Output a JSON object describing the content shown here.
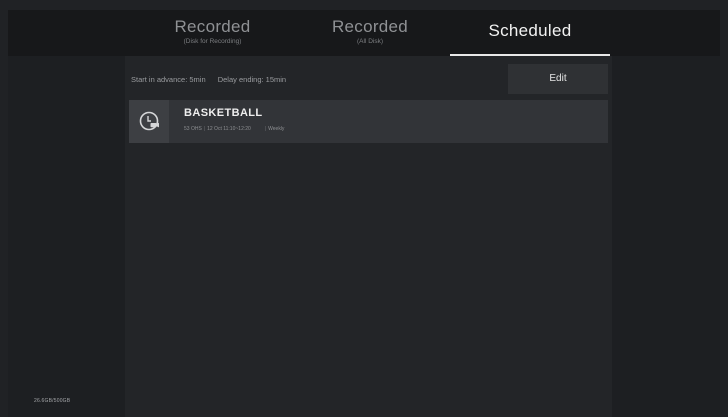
{
  "tabs": [
    {
      "title": "Recorded",
      "subtitle": "(Disk for Recording)",
      "active": false
    },
    {
      "title": "Recorded",
      "subtitle": "(All Disk)",
      "active": false
    },
    {
      "title": "Scheduled",
      "subtitle": "",
      "active": true
    }
  ],
  "settings": {
    "start_in_advance": "Start in advance: 5min",
    "delay_ending": "Delay ending: 15min"
  },
  "toolbar": {
    "edit_label": "Edit"
  },
  "schedule_items": [
    {
      "title": "BASKETBALL",
      "channel": "53 OHS",
      "time": "12 Oct 11:10~12:20",
      "repeat": "Weekly",
      "icon": "clock-record-icon"
    }
  ],
  "footer": {
    "disk_usage": "26.6GB/500GB"
  },
  "colors": {
    "background": "#202225",
    "tabbar": "#17181a",
    "active_tab_text": "#f2f2f2",
    "item_background": "#323438",
    "button_background": "#2f3134"
  }
}
